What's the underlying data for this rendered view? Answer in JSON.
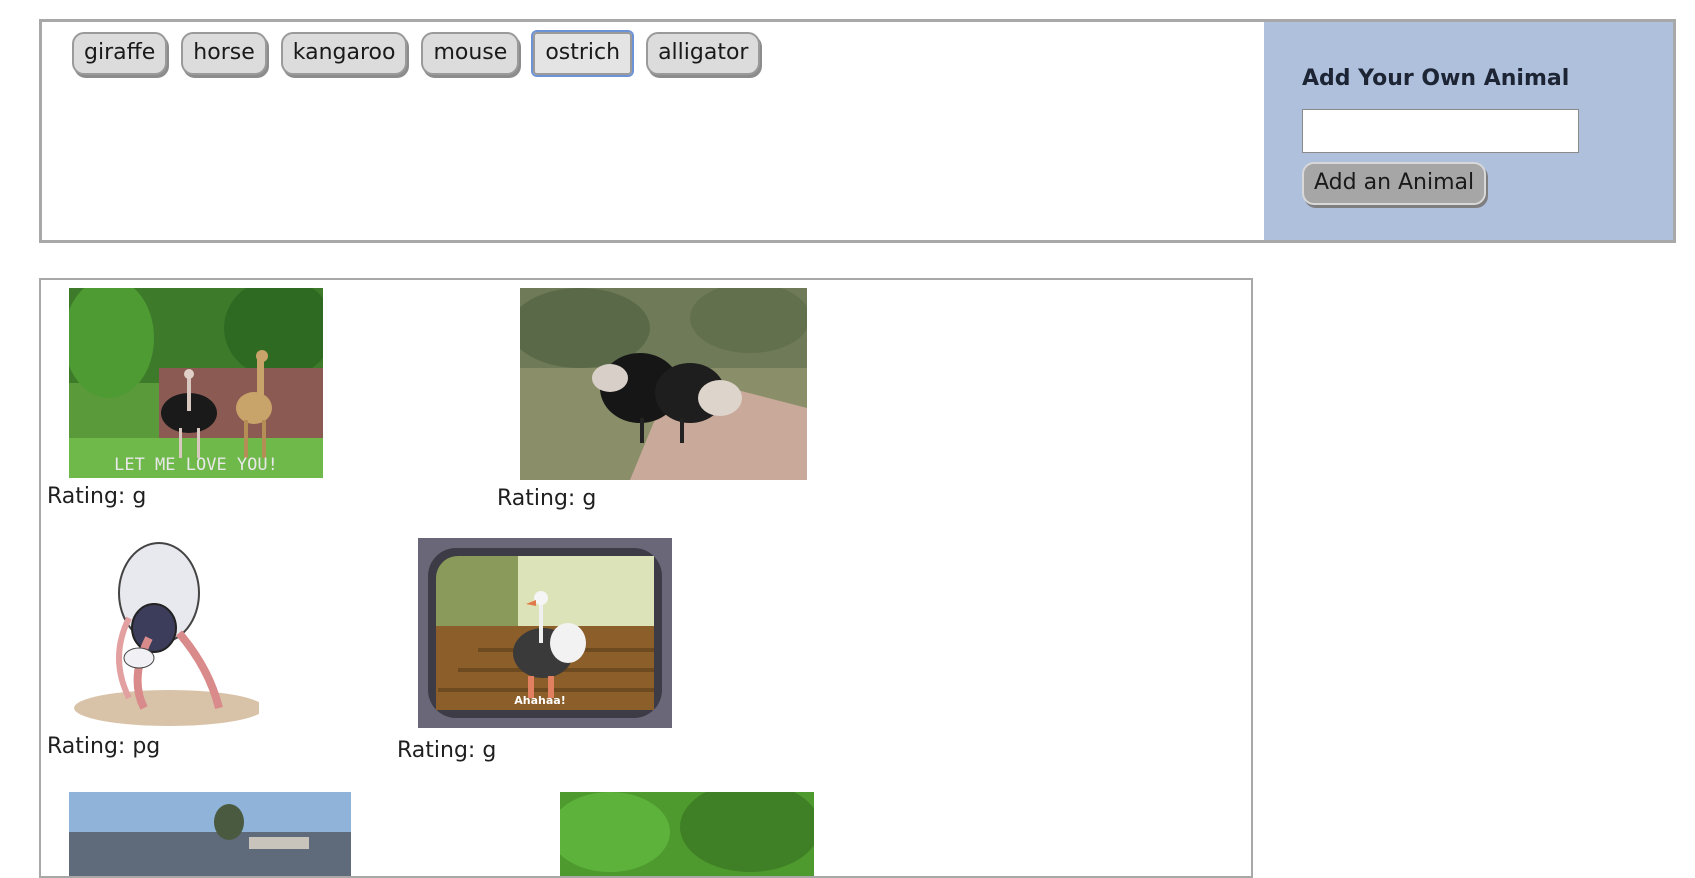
{
  "animal_buttons": [
    {
      "label": "giraffe"
    },
    {
      "label": "horse"
    },
    {
      "label": "kangaroo"
    },
    {
      "label": "mouse"
    },
    {
      "label": "ostrich"
    },
    {
      "label": "alligator"
    }
  ],
  "add_form": {
    "heading": "Add Your Own Animal",
    "input_value": "",
    "button_label": "Add an Animal"
  },
  "gifs": [
    {
      "rating": "Rating: g",
      "caption": "LET ME LOVE YOU!"
    },
    {
      "rating": "Rating: g"
    },
    {
      "rating": "Rating: pg"
    },
    {
      "rating": "Rating: g",
      "caption": "Ahahaa!"
    },
    {
      "rating": ""
    },
    {
      "rating": ""
    }
  ]
}
